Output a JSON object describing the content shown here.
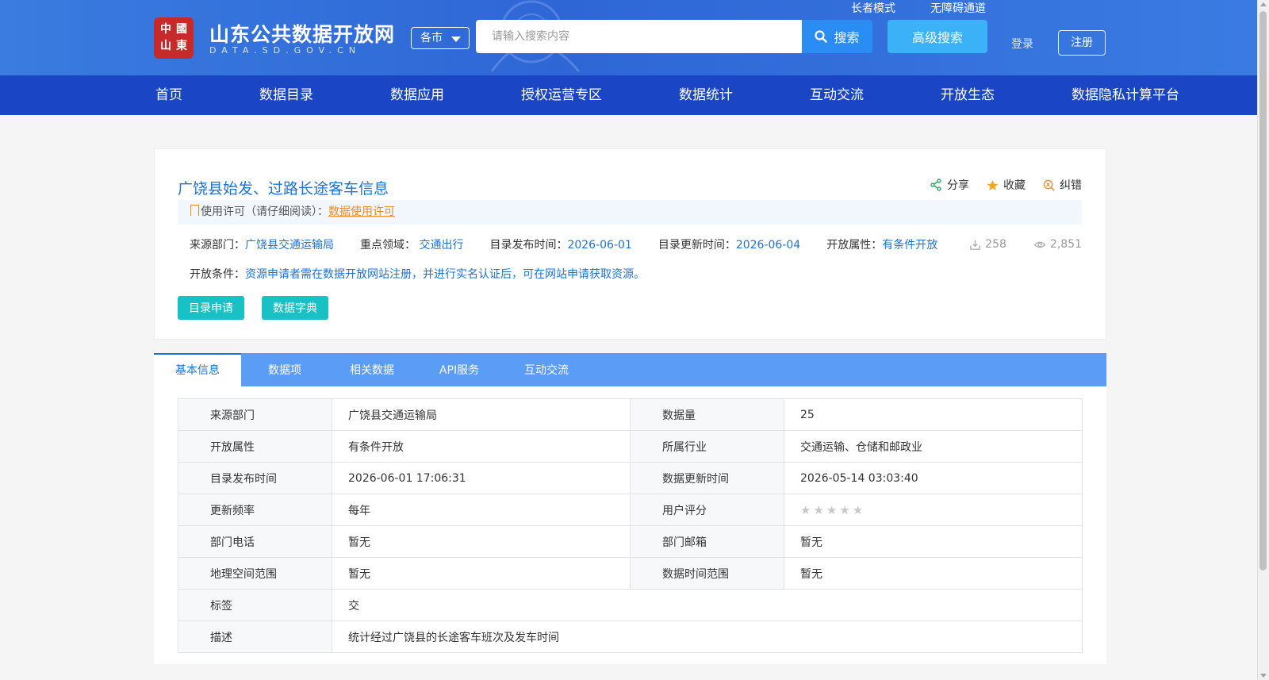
{
  "header": {
    "logo_seal_chars": [
      "中",
      "國",
      "山",
      "東"
    ],
    "logo_title": "山东公共数据开放网",
    "logo_sub": "DATA.SD.GOV.CN",
    "city_select": "各市",
    "search_placeholder": "请输入搜索内容",
    "search_btn": "搜索",
    "advanced_btn": "高级搜索",
    "elder_mode": "长者模式",
    "accessibility": "无障碍通道",
    "login": "登录",
    "register": "注册"
  },
  "nav": [
    "首页",
    "数据目录",
    "数据应用",
    "授权运营专区",
    "数据统计",
    "互动交流",
    "开放生态",
    "数据隐私计算平台"
  ],
  "dataset": {
    "title": "广饶县始发、过路长途客车信息",
    "share": "分享",
    "favorite": "收藏",
    "correct": "纠错",
    "license_label": "使用许可（请仔细阅读）：",
    "license_link": "数据使用许可",
    "source_label": "来源部门：",
    "source_value": "广饶县交通运输局",
    "field_label": "重点领域：",
    "field_value": "交通出行",
    "pub_label": "目录发布时间：",
    "pub_value": "2026-06-01",
    "upd_label": "目录更新时间：",
    "upd_value": "2026-06-04",
    "open_label": "开放属性：",
    "open_value": "有条件开放",
    "downloads": "258",
    "views": "2,851",
    "cond_label": "开放条件：",
    "cond_value": "资源申请者需在数据开放网站注册，并进行实名认证后，可在网站申请获取资源。",
    "apply_btn": "目录申请",
    "dict_btn": "数据字典"
  },
  "tabs": [
    "基本信息",
    "数据项",
    "相关数据",
    "API服务",
    "互动交流"
  ],
  "info_rows": [
    {
      "k1": "来源部门",
      "v1": "广饶县交通运输局",
      "k2": "数据量",
      "v2": "25"
    },
    {
      "k1": "开放属性",
      "v1": "有条件开放",
      "k2": "所属行业",
      "v2": "交通运输、仓储和邮政业"
    },
    {
      "k1": "目录发布时间",
      "v1": "2026-06-01 17:06:31",
      "k2": "数据更新时间",
      "v2": "2026-05-14 03:03:40"
    },
    {
      "k1": "更新频率",
      "v1": "每年",
      "k2": "用户评分",
      "v2": ""
    },
    {
      "k1": "部门电话",
      "v1": "暂无",
      "k2": "部门邮箱",
      "v2": "暂无"
    },
    {
      "k1": "地理空间范围",
      "v1": "暂无",
      "k2": "数据时间范围",
      "v2": "暂无"
    }
  ],
  "tag_row": {
    "k": "标签",
    "v": "交"
  },
  "desc_row": {
    "k": "描述",
    "v": "统计经过广饶县的长途客车班次及发车时间"
  },
  "rating": {
    "value": 0,
    "max": 5
  },
  "colors": {
    "header_blue": "#2e66d6",
    "nav_blue": "#1a45c4",
    "link_blue": "#1b73d8",
    "teal": "#17c1c6",
    "tab_bar": "#5b9cf7",
    "license_orange": "#f08a24"
  }
}
